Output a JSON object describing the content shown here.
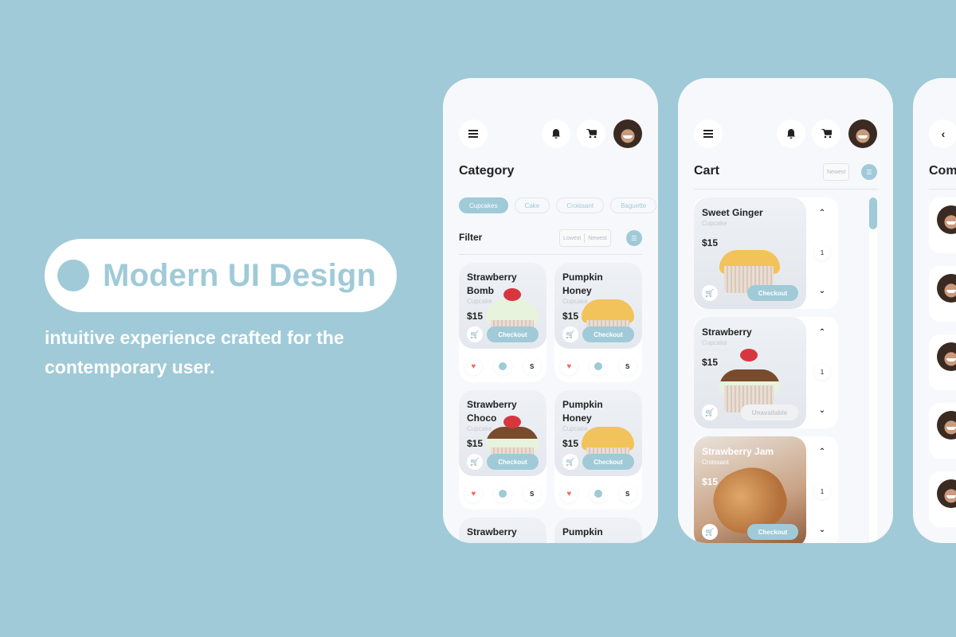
{
  "hero": {
    "title": "Modern UI Design",
    "subtitle": "intuitive experience crafted for the contemporary user."
  },
  "colors": {
    "accent": "#a0cad7",
    "background": "#a0cad7",
    "heart": "#e8745e"
  },
  "screen_category": {
    "icons": [
      "menu-icon",
      "bell-icon",
      "cart-icon",
      "avatar"
    ],
    "title": "Category",
    "chips": [
      {
        "label": "Cupcakes",
        "active": true
      },
      {
        "label": "Cake",
        "active": false
      },
      {
        "label": "Croissant",
        "active": false
      },
      {
        "label": "Baguette",
        "active": false
      }
    ],
    "filter_label": "Filter",
    "sort_options": [
      "Lowest",
      "Newest"
    ],
    "products": [
      {
        "name": "Strawberry Bomb",
        "category": "Cupcake",
        "price": "$15",
        "button": "Checkout",
        "size": "S"
      },
      {
        "name": "Pumpkin Honey",
        "category": "Cupcake",
        "price": "$15",
        "button": "Checkout",
        "size": "S"
      },
      {
        "name": "Strawberry Choco",
        "category": "Cupcake",
        "price": "$15",
        "button": "Checkout",
        "size": "S"
      },
      {
        "name": "Pumpkin Honey",
        "category": "Cupcake",
        "price": "$15",
        "button": "Checkout",
        "size": "S"
      },
      {
        "name": "Strawberry",
        "category": "",
        "price": "",
        "button": "",
        "size": ""
      },
      {
        "name": "Pumpkin",
        "category": "",
        "price": "",
        "button": "",
        "size": ""
      }
    ]
  },
  "screen_cart": {
    "title": "Cart",
    "sort_option": "Newest",
    "items": [
      {
        "name": "Sweet Ginger",
        "category": "Cupcake",
        "price": "$15",
        "button": "Checkout",
        "quantity": "1"
      },
      {
        "name": "Strawberry",
        "category": "Cupcake",
        "price": "$15",
        "button": "Unavailable",
        "quantity": "1"
      },
      {
        "name": "Strawberry Jam",
        "category": "Croissant",
        "price": "$15",
        "button": "Checkout",
        "quantity": "1"
      }
    ]
  },
  "screen_comments": {
    "title": "Com",
    "comment_count_visible": 5
  }
}
